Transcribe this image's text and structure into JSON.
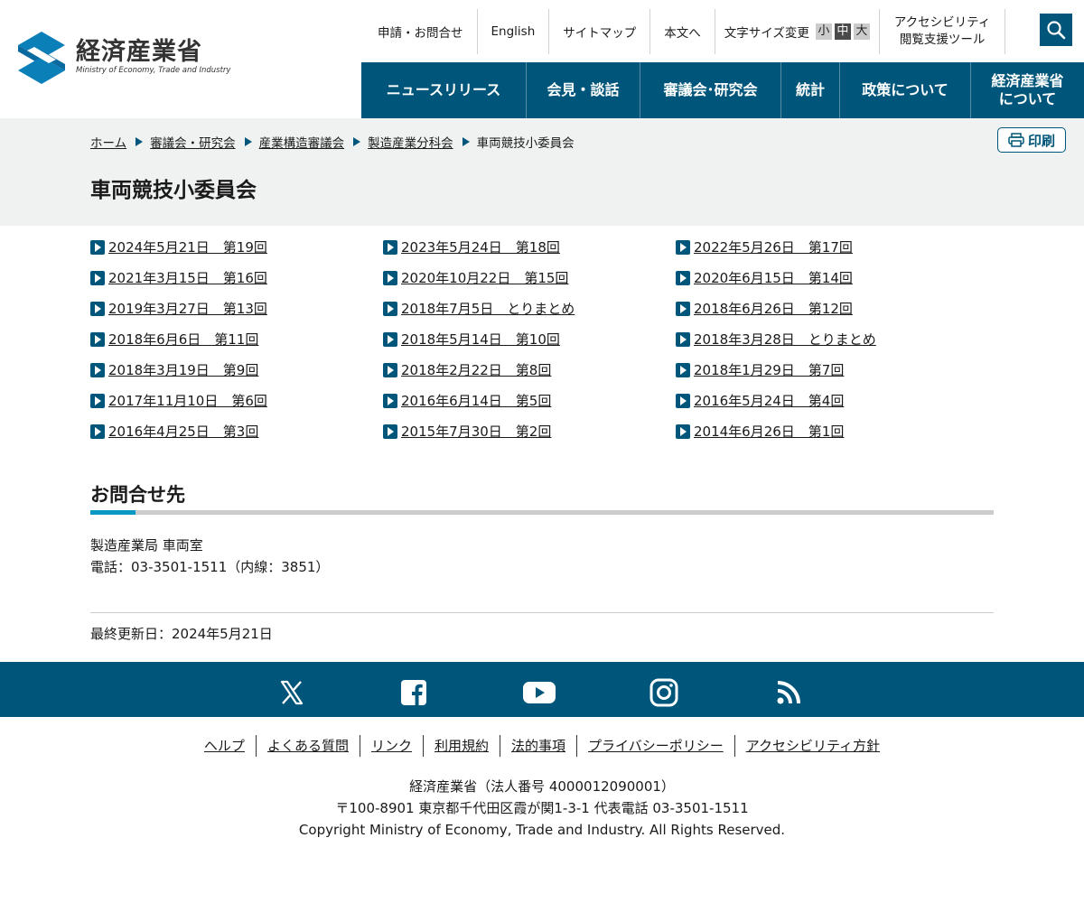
{
  "brand": {
    "name_jp": "経済産業省",
    "name_en": "Ministry of Economy, Trade and Industry",
    "color": "#00567a"
  },
  "util_nav": {
    "apply_contact": "申請・お問合せ",
    "english": "English",
    "sitemap": "サイトマップ",
    "to_body": "本文へ",
    "font_size_label": "文字サイズ変更",
    "font_small": "小",
    "font_medium": "中",
    "font_large": "大",
    "a11y_line1": "アクセシビリティ",
    "a11y_line2": "閲覧支援ツール",
    "search_icon": "search-icon"
  },
  "global_nav": {
    "news": "ニュースリリース",
    "press": "会見・談話",
    "council": "審議会･研究会",
    "stats": "統計",
    "policy": "政策について",
    "about_line1": "経済産業省",
    "about_line2": "について"
  },
  "breadcrumb": {
    "home": "ホーム",
    "council": "審議会・研究会",
    "industrial_structure": "産業構造審議会",
    "manufacturing": "製造産業分科会",
    "current": "車両競技小委員会"
  },
  "print_label": "印刷",
  "page_title": "車両競技小委員会",
  "meetings": [
    "2024年5月21日　第19回",
    "2023年5月24日　第18回",
    "2022年5月26日　第17回",
    "2021年3月15日　第16回",
    "2020年10月22日　第15回",
    "2020年6月15日　第14回",
    "2019年3月27日　第13回",
    "2018年7月5日　とりまとめ",
    "2018年6月26日　第12回",
    "2018年6月6日　第11回",
    "2018年5月14日　第10回",
    "2018年3月28日　とりまとめ",
    "2018年3月19日　第9回",
    "2018年2月22日　第8回",
    "2018年1月29日　第7回",
    "2017年11月10日　第6回",
    "2016年6月14日　第5回",
    "2016年5月24日　第4回",
    "2016年4月25日　第3回",
    "2015年7月30日　第2回",
    "2014年6月26日　第1回"
  ],
  "contact": {
    "heading": "お問合せ先",
    "dept": "製造産業局 車両室",
    "phone": "電話：03-3501-1511（内線：3851）"
  },
  "last_updated": "最終更新日：2024年5月21日",
  "social": [
    "x-icon",
    "facebook-icon",
    "youtube-icon",
    "instagram-icon",
    "rss-icon"
  ],
  "footer": {
    "links": [
      "ヘルプ",
      "よくある質問",
      "リンク",
      "利用規約",
      "法的事項",
      "プライバシーポリシー",
      "アクセシビリティ方針"
    ],
    "org": "経済産業省（法人番号 4000012090001）",
    "address": "〒100-8901 東京都千代田区霞が関1-3-1 代表電話 03-3501-1511",
    "copyright": "Copyright Ministry of Economy, Trade and Industry. All Rights Reserved."
  }
}
